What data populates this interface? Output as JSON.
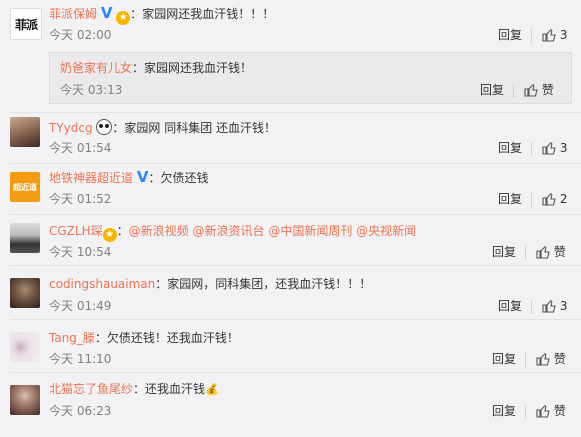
{
  "comments": [
    {
      "user": "菲派保姆",
      "content": "：家园网还我血汗钱！！！",
      "time": "今天 02:00",
      "reply": "回复",
      "likes": "3",
      "avatar_text": "菲派",
      "subreply": {
        "user": "奶爸家有儿女",
        "content": "：家园网还我血汗钱！",
        "time": "今天 03:13",
        "reply": "回复",
        "like_label": "赞"
      }
    },
    {
      "user": "TYydcg",
      "content": "：家园网 同科集团 还血汗钱！",
      "time": "今天 01:54",
      "reply": "回复",
      "likes": "3"
    },
    {
      "user": "地铁神器超近道",
      "content": "：欠债还钱",
      "time": "今天 01:52",
      "reply": "回复",
      "likes": "2",
      "avatar_text": "超近道"
    },
    {
      "user": "CGZLH琛",
      "content_prefix": "：",
      "mentions": [
        "@新浪视频",
        "@新浪资讯台",
        "@中国新闻周刊",
        "@央视新闻"
      ],
      "time": "今天 10:54",
      "reply": "回复",
      "like_label": "赞"
    },
    {
      "user": "codingshauaiman",
      "content": "：家园网，同科集团，还我血汗钱！！！",
      "time": "今天 01:49",
      "reply": "回复",
      "likes": "3"
    },
    {
      "user": "Tang_滕",
      "content": "：欠债还钱！还我血汗钱！",
      "time": "今天 11:10",
      "reply": "回复",
      "like_label": "赞"
    },
    {
      "user": "北猫忘了鱼尾纱",
      "content": "：还我血汗钱",
      "time": "今天 06:23",
      "reply": "回复",
      "like_label": "赞"
    }
  ],
  "colors": {
    "username": "#eb7350",
    "verified": "#2a84ff",
    "background": "#f2f2f5"
  }
}
